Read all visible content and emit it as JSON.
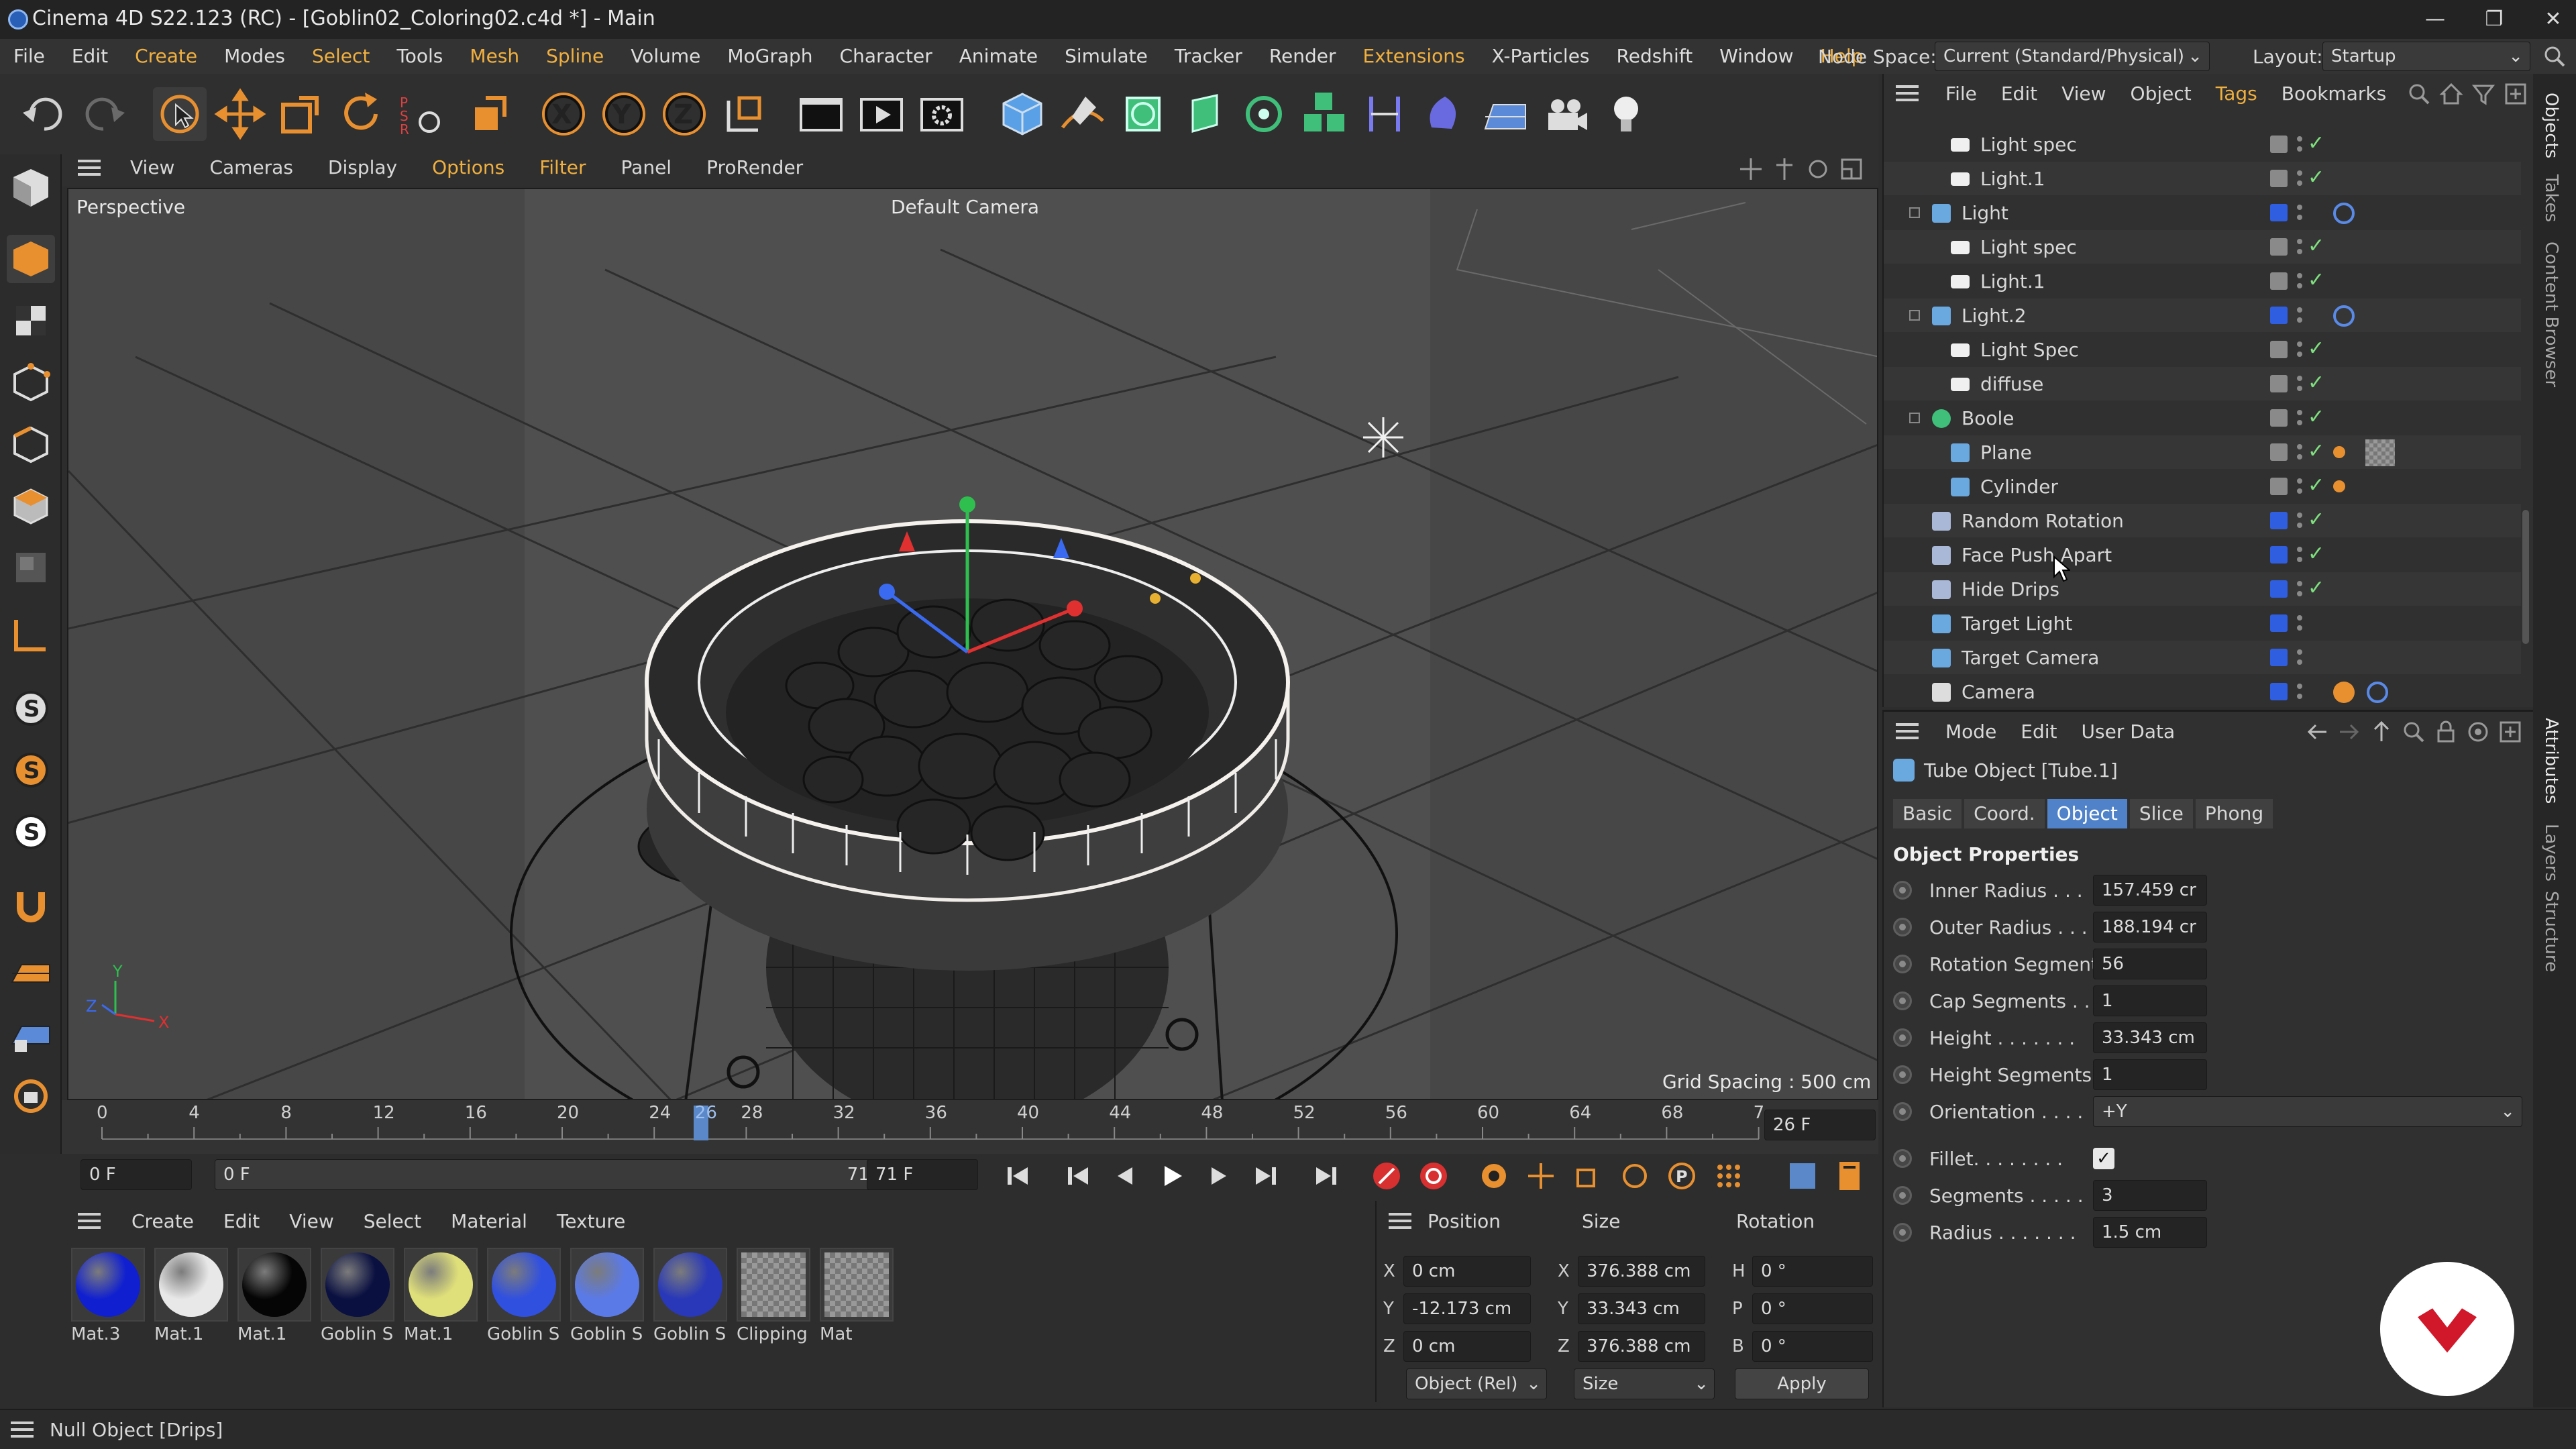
{
  "app": {
    "title": "Cinema 4D S22.123 (RC) - [Goblin02_Coloring02.c4d *] - Main",
    "window_buttons": [
      "—",
      "❐",
      "✕"
    ]
  },
  "menubar": {
    "items": [
      "File",
      "Edit",
      "Create",
      "Modes",
      "Select",
      "Tools",
      "Mesh",
      "Spline",
      "Volume",
      "MoGraph",
      "Character",
      "Animate",
      "Simulate",
      "Tracker",
      "Render",
      "Extensions",
      "X-Particles",
      "Redshift",
      "Window",
      "Help"
    ],
    "node_space_label": "Node Space:",
    "node_space_value": "Current (Standard/Physical)",
    "layout_label": "Layout:",
    "layout_value": "Startup"
  },
  "viewport": {
    "menu": [
      "View",
      "Cameras",
      "Display",
      "Options",
      "Filter",
      "Panel",
      "ProRender"
    ],
    "label": "Perspective",
    "camera": "Default Camera",
    "grid_spacing": "Grid Spacing : 500 cm",
    "axis": {
      "x": "X",
      "y": "Y",
      "z": "Z"
    }
  },
  "timeline": {
    "ticks": [
      "0",
      "4",
      "8",
      "12",
      "16",
      "20",
      "24",
      "26",
      "28",
      "32",
      "36",
      "40",
      "44",
      "48",
      "52",
      "56",
      "60",
      "64",
      "68",
      "7"
    ],
    "current_frame": "26",
    "end_frame_field": "26 F",
    "start_field": "0 F",
    "range_start": "0 F",
    "range_end": "71 F",
    "end_field": "71 F"
  },
  "materials": {
    "menu": [
      "Create",
      "Edit",
      "View",
      "Select",
      "Material",
      "Texture"
    ],
    "items": [
      {
        "name": "Mat.3",
        "color": "#1020d0"
      },
      {
        "name": "Mat.1",
        "color": "#e8e8e8"
      },
      {
        "name": "Mat.1",
        "color": "#050505"
      },
      {
        "name": "Goblin S",
        "color": "#0a1040"
      },
      {
        "name": "Mat.1",
        "color": "#e0e07a"
      },
      {
        "name": "Goblin S",
        "color": "#3050e0"
      },
      {
        "name": "Goblin S",
        "color": "#5a7ae8"
      },
      {
        "name": "Goblin S",
        "color": "#2838b8"
      },
      {
        "name": "Clipping",
        "color": "checker"
      },
      {
        "name": "Mat",
        "color": "checker"
      }
    ]
  },
  "coords": {
    "headers": [
      "Position",
      "Size",
      "Rotation"
    ],
    "rows": [
      {
        "a1": "X",
        "v1": "0 cm",
        "a2": "X",
        "v2": "376.388 cm",
        "a3": "H",
        "v3": "0 °"
      },
      {
        "a1": "Y",
        "v1": "-12.173 cm",
        "a2": "Y",
        "v2": "33.343 cm",
        "a3": "P",
        "v3": "0 °"
      },
      {
        "a1": "Z",
        "v1": "0 cm",
        "a2": "Z",
        "v2": "376.388 cm",
        "a3": "B",
        "v3": "0 °"
      }
    ],
    "mode_select": "Object (Rel)",
    "size_select": "Size",
    "apply_label": "Apply"
  },
  "status": {
    "text": "Null Object [Drips]"
  },
  "objects": {
    "menu": [
      "File",
      "Edit",
      "View",
      "Object",
      "Tags",
      "Bookmarks"
    ],
    "rows": [
      {
        "name": "Light spec",
        "indent": 2,
        "icon": "white",
        "color": "gray",
        "check": true
      },
      {
        "name": "Light.1",
        "indent": 2,
        "icon": "white",
        "color": "gray",
        "check": true
      },
      {
        "name": "Light",
        "indent": 1,
        "icon": "light",
        "color": "blue",
        "check": false,
        "tag": "target"
      },
      {
        "name": "Light spec",
        "indent": 2,
        "icon": "white",
        "color": "gray",
        "check": true
      },
      {
        "name": "Light.1",
        "indent": 2,
        "icon": "white",
        "color": "gray",
        "check": true
      },
      {
        "name": "Light.2",
        "indent": 1,
        "icon": "light",
        "color": "blue",
        "check": false,
        "tag": "target"
      },
      {
        "name": "Light Spec",
        "indent": 2,
        "icon": "white",
        "color": "gray",
        "check": true
      },
      {
        "name": "diffuse",
        "indent": 2,
        "icon": "white",
        "color": "gray",
        "check": true
      },
      {
        "name": "Boole",
        "indent": 1,
        "icon": "boole",
        "color": "gray",
        "check": true
      },
      {
        "name": "Plane",
        "indent": 2,
        "icon": "plane",
        "color": "gray",
        "check": true,
        "tag": "mat"
      },
      {
        "name": "Cylinder",
        "indent": 2,
        "icon": "cyl",
        "color": "gray",
        "check": true,
        "tag": "dots"
      },
      {
        "name": "Random Rotation",
        "indent": 1,
        "icon": "effector",
        "color": "blue",
        "check": true
      },
      {
        "name": "Face Push Apart",
        "indent": 1,
        "icon": "effector2",
        "color": "blue",
        "check": true
      },
      {
        "name": "Hide Drips",
        "indent": 1,
        "icon": "effector3",
        "color": "blue",
        "check": true
      },
      {
        "name": "Target Light",
        "indent": 1,
        "icon": "light",
        "color": "blue",
        "check": false
      },
      {
        "name": "Target Camera",
        "indent": 1,
        "icon": "light",
        "color": "blue",
        "check": false
      },
      {
        "name": "Camera",
        "indent": 1,
        "icon": "camera",
        "color": "blue",
        "check": false,
        "tag": "camera"
      }
    ]
  },
  "attributes": {
    "menu": [
      "Mode",
      "Edit",
      "User Data"
    ],
    "object_title": "Tube Object [Tube.1]",
    "tabs": [
      "Basic",
      "Coord.",
      "Object",
      "Slice",
      "Phong"
    ],
    "active_tab": "Object",
    "section": "Object Properties",
    "props": [
      {
        "label": "Inner Radius . . .",
        "value": "157.459 cr"
      },
      {
        "label": "Outer Radius . . .",
        "value": "188.194 cr"
      },
      {
        "label": "Rotation Segments",
        "value": "56"
      },
      {
        "label": "Cap Segments . .",
        "value": "1"
      },
      {
        "label": "Height . . . . . . .",
        "value": "33.343 cm"
      },
      {
        "label": "Height Segments",
        "value": "1"
      },
      {
        "label": "Orientation . . . .",
        "value": "+Y"
      },
      {
        "label": "Fillet. . . . . . . .",
        "value": "✓"
      },
      {
        "label": "Segments . . . . .",
        "value": "3"
      },
      {
        "label": "Radius . . . . . . .",
        "value": "1.5 cm"
      }
    ]
  },
  "side_tabs": [
    "Objects",
    "Takes",
    "Content Browser",
    "Attributes",
    "Layers",
    "Structure"
  ]
}
